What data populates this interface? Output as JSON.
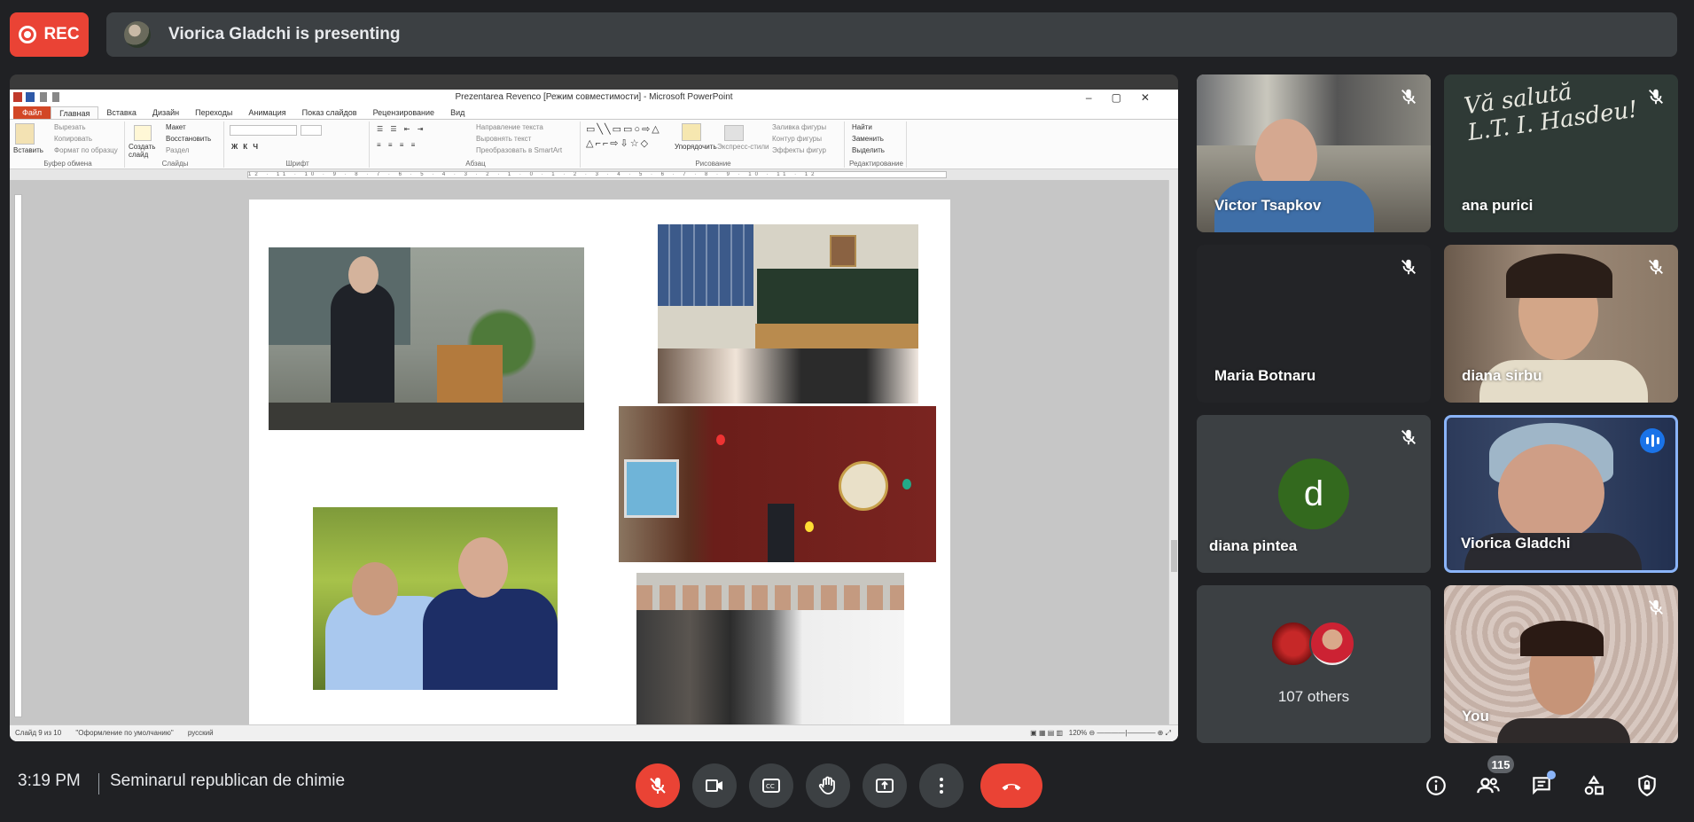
{
  "recording": {
    "label": "REC"
  },
  "presenting": {
    "text": "Viorica Gladchi is presenting"
  },
  "ppt": {
    "title": "Prezentarea Revenco [Режим совместимости] - Microsoft PowerPoint",
    "tabs": [
      "Файл",
      "Главная",
      "Вставка",
      "Дизайн",
      "Переходы",
      "Анимация",
      "Показ слайдов",
      "Рецензирование",
      "Вид"
    ],
    "ribbon": {
      "paste": "Вставить",
      "cut": "Вырезать",
      "copy": "Копировать",
      "format_painter": "Формат по образцу",
      "clipboard": "Буфер обмена",
      "new_slide": "Создать слайд",
      "layout": "Макет",
      "reset": "Восстановить",
      "section": "Раздел",
      "slides": "Слайды",
      "font": "Шрифт",
      "text_direction": "Направление текста",
      "align_text": "Выровнять текст",
      "convert_smartart": "Преобразовать в SmartArt",
      "paragraph": "Абзац",
      "arrange": "Упорядочить",
      "quick_styles": "Экспресс-стили",
      "shape_fill": "Заливка фигуры",
      "shape_outline": "Контур фигуры",
      "shape_effects": "Эффекты фигур",
      "drawing": "Рисование",
      "find": "Найти",
      "replace": "Заменить",
      "select": "Выделить",
      "editing": "Редактирование"
    },
    "ruler_text": "12 · 11 · 10 · 9 · 8 · 7 · 6 · 5 · 4 · 3 · 2 · 1 · 0 · 1 · 2 · 3 · 4 · 5 · 6 · 7 · 8 · 9 · 10 · 11 · 12",
    "status": {
      "slide": "Слайд 9 из 10",
      "theme": "\"Оформление по умолчанию\"",
      "lang": "русский",
      "zoom": "120%"
    }
  },
  "participants": [
    {
      "name": "Victor Tsapkov",
      "muted": true
    },
    {
      "name": "ana purici",
      "muted": true
    },
    {
      "name": "Maria Botnaru",
      "muted": true
    },
    {
      "name": "diana sirbu",
      "muted": true
    },
    {
      "name": "diana pintea",
      "muted": true,
      "initial": "d",
      "avatar_color": "#33691e"
    },
    {
      "name": "Viorica Gladchi",
      "muted": false,
      "speaking": true
    },
    {
      "name": "You",
      "muted": true
    }
  ],
  "others": {
    "label": "107 others"
  },
  "footer": {
    "time": "3:19 PM",
    "meeting_name": "Seminarul republican de chimie",
    "people_count": "115"
  },
  "colors": {
    "red": "#ea4335",
    "bg": "#202124",
    "tile": "#3c4043",
    "blue": "#1a73e8"
  }
}
